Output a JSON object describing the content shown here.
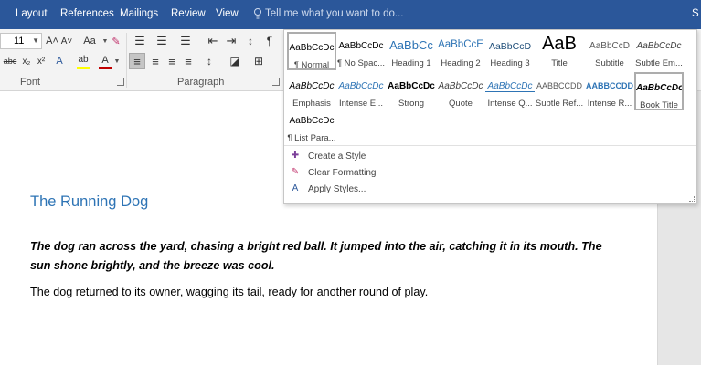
{
  "tabs": [
    "Layout",
    "References",
    "Mailings",
    "Review",
    "View"
  ],
  "tell_me": "Tell me what you want to do...",
  "edge_letter": "S",
  "ribbon": {
    "font_size": "11",
    "font_group": "Font",
    "paragraph_group": "Paragraph",
    "glyphs": {
      "grow": "A˄",
      "shrink": "A˅",
      "case": "Aa",
      "strike": "abc",
      "sub": "x₂",
      "sup": "x²",
      "fx": "A",
      "highlight": "ab",
      "fontcolor": "A",
      "pilcrow": "¶"
    }
  },
  "gallery": {
    "row1": [
      {
        "sample": "AaBbCcDc",
        "name": "¶ Normal"
      },
      {
        "sample": "AaBbCcDc",
        "name": "¶ No Spac..."
      },
      {
        "sample": "AaBbCc",
        "name": "Heading 1"
      },
      {
        "sample": "AaBbCcE",
        "name": "Heading 2"
      },
      {
        "sample": "AaBbCcD",
        "name": "Heading 3"
      },
      {
        "sample": "AaB",
        "name": "Title"
      },
      {
        "sample": "AaBbCcD",
        "name": "Subtitle"
      },
      {
        "sample": "AaBbCcDc",
        "name": "Subtle Em..."
      }
    ],
    "row2": [
      {
        "sample": "AaBbCcDc",
        "name": "Emphasis"
      },
      {
        "sample": "AaBbCcDc",
        "name": "Intense E..."
      },
      {
        "sample": "AaBbCcDc",
        "name": "Strong"
      },
      {
        "sample": "AaBbCcDc",
        "name": "Quote"
      },
      {
        "sample": "AaBbCcDc",
        "name": "Intense Q..."
      },
      {
        "sample": "AABBCCDD",
        "name": "Subtle Ref..."
      },
      {
        "sample": "AABBCCDD",
        "name": "Intense R..."
      },
      {
        "sample": "AaBbCcDc",
        "name": "Book Title"
      }
    ],
    "row3": [
      {
        "sample": "AaBbCcDc",
        "name": "¶ List Para..."
      }
    ],
    "commands": [
      "Create a Style",
      "Clear Formatting",
      "Apply Styles..."
    ]
  },
  "document": {
    "heading": "The Running Dog",
    "para1": "The dog ran across the yard, chasing a bright red ball. It jumped into the air, catching it in its mouth. The sun shone brightly, and the breeze was cool.",
    "para2": "The dog returned to its owner, wagging its tail, ready for another round of play."
  },
  "colors": {
    "ribbon_blue": "#2b579a",
    "heading_blue": "#2e74b5",
    "font_red": "#c00000",
    "highlight_yellow": "#ffff00"
  }
}
